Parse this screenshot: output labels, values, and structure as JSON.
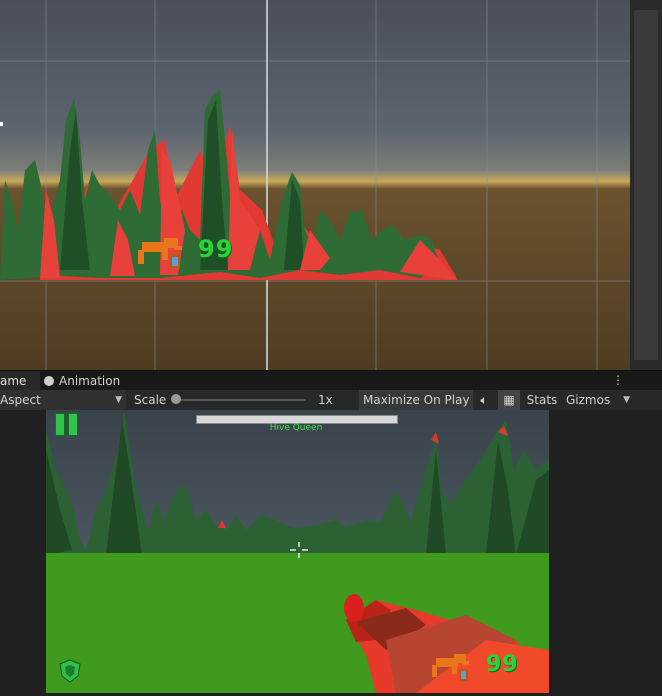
{
  "tabs": {
    "game_label": "ame",
    "animation_label": "Animation",
    "more_icon": "kebab-icon"
  },
  "toolbar": {
    "aspect_label": "Aspect",
    "scale_label": "Scale",
    "scale_value": "1x",
    "maximize_label": "Maximize On Play",
    "stats_label": "Stats",
    "gizmos_label": "Gizmos"
  },
  "game": {
    "boss_name": "Hive Queen",
    "boss_health_fraction": 1.0,
    "ammo_count": "99"
  },
  "scene": {
    "ammo_count": "99"
  },
  "colors": {
    "hud_green": "#2bd33a",
    "terrain_green": "#2f6b35",
    "terrain_red": "#e8403a",
    "ground_green": "#3f9a1e",
    "editor_dark": "#282828"
  }
}
